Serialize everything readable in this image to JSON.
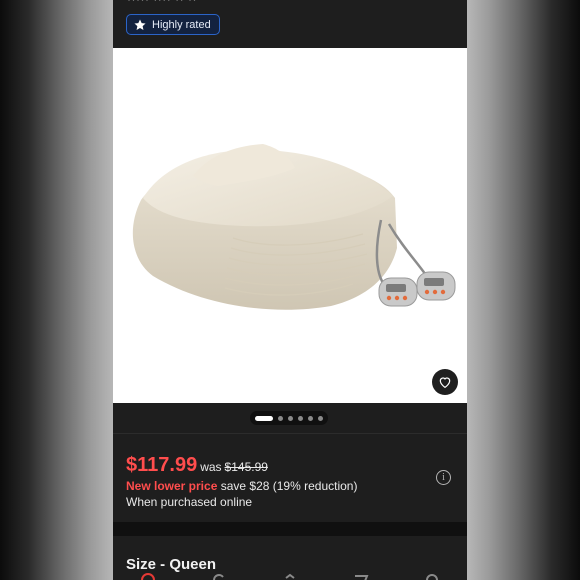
{
  "header": {
    "partial_text": "····· ···· ·· ··",
    "badge_label": "Highly rated"
  },
  "gallery": {
    "total_images": 6,
    "active_index": 0
  },
  "pricing": {
    "current_price": "$117.99",
    "was_label": "was",
    "original_price": "$145.99",
    "promo_label": "New lower price",
    "savings_text": "save $28 (19% reduction)",
    "availability": "When purchased online"
  },
  "variant": {
    "size_label": "Size - Queen"
  },
  "icons": {
    "badge": "star-icon",
    "favorite": "heart-icon",
    "info": "info-icon",
    "tabs": [
      "target-home-icon",
      "refresh-icon",
      "category-icon",
      "cart-icon",
      "account-icon"
    ]
  },
  "colors": {
    "price_red": "#ff4d4d",
    "badge_blue": "#2b64c8",
    "panel_dark": "#1e1e1e",
    "blanket_cream": "#ece6d9"
  }
}
